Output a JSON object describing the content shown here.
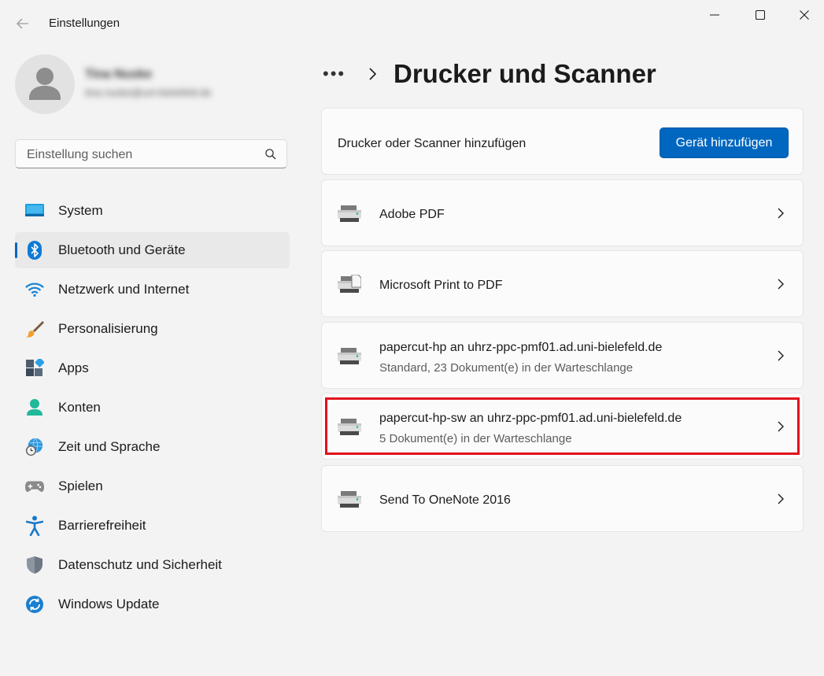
{
  "window": {
    "title": "Einstellungen"
  },
  "profile": {
    "name": "Tina Nuske",
    "email": "tina.nuske@uni-bielefeld.de"
  },
  "search": {
    "placeholder": "Einstellung suchen"
  },
  "sidebar": {
    "items": [
      {
        "label": "System",
        "icon": "system-icon",
        "active": false
      },
      {
        "label": "Bluetooth und Geräte",
        "icon": "bluetooth-icon",
        "active": true
      },
      {
        "label": "Netzwerk und Internet",
        "icon": "wifi-icon",
        "active": false
      },
      {
        "label": "Personalisierung",
        "icon": "brush-icon",
        "active": false
      },
      {
        "label": "Apps",
        "icon": "apps-icon",
        "active": false
      },
      {
        "label": "Konten",
        "icon": "account-icon",
        "active": false
      },
      {
        "label": "Zeit und Sprache",
        "icon": "globe-clock-icon",
        "active": false
      },
      {
        "label": "Spielen",
        "icon": "gamepad-icon",
        "active": false
      },
      {
        "label": "Barrierefreiheit",
        "icon": "accessibility-icon",
        "active": false
      },
      {
        "label": "Datenschutz und Sicherheit",
        "icon": "shield-icon",
        "active": false
      },
      {
        "label": "Windows Update",
        "icon": "update-icon",
        "active": false
      }
    ]
  },
  "header": {
    "more": "•••",
    "title": "Drucker und Scanner"
  },
  "add_device": {
    "label": "Drucker oder Scanner hinzufügen",
    "button": "Gerät hinzufügen"
  },
  "printers": [
    {
      "name": "Adobe PDF",
      "status": ""
    },
    {
      "name": "Microsoft Print to PDF",
      "status": ""
    },
    {
      "name": "papercut-hp an uhrz-ppc-pmf01.ad.uni-bielefeld.de",
      "status": "Standard, 23 Dokument(e) in der Warteschlange"
    },
    {
      "name": "papercut-hp-sw an uhrz-ppc-pmf01.ad.uni-bielefeld.de",
      "status": "5 Dokument(e) in der Warteschlange"
    },
    {
      "name": "Send To OneNote 2016",
      "status": ""
    }
  ],
  "colors": {
    "accent": "#0067c0",
    "highlight": "#e0121c"
  }
}
